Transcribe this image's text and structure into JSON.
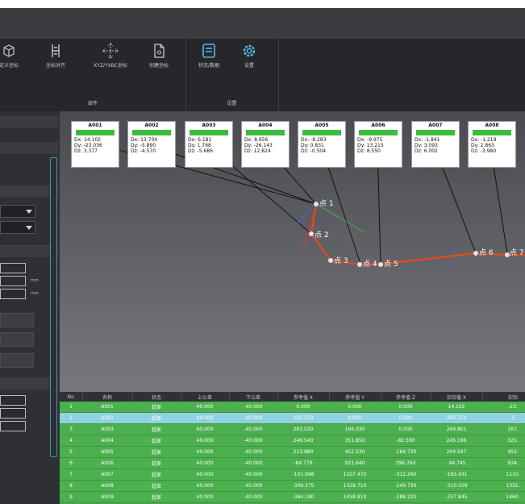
{
  "ribbon": {
    "group1": {
      "title": "部件",
      "buttons": [
        {
          "label": "定义坐标",
          "icon": "cube-axis-icon"
        },
        {
          "label": "坐标对齐",
          "icon": "align-icon"
        },
        {
          "label": "XYZ/YXBC坐标",
          "icon": "move-arrows-icon"
        },
        {
          "label": "创建坐标",
          "icon": "document-icon"
        }
      ]
    },
    "group2": {
      "title": "设置",
      "buttons": [
        {
          "label": "状态/数据",
          "icon": "status-panel-icon"
        },
        {
          "label": "设置",
          "icon": "gear-icon"
        }
      ]
    }
  },
  "leftpanel": {
    "unit_mm_1": "mm",
    "unit_mm_2": "mm"
  },
  "viewport": {
    "point_boxes": [
      {
        "name": "A001",
        "dx": "Dx: 14.102",
        "dy": "Dy: -23.036",
        "dz": "Dz: 3.377"
      },
      {
        "name": "A002",
        "dx": "Dx: 13.704",
        "dy": "Dy: -5.890",
        "dz": "Dz: -4.570"
      },
      {
        "name": "A003",
        "dx": "Dx: 6.181",
        "dy": "Dy: 1.768",
        "dz": "Dz: -5.686"
      },
      {
        "name": "A004",
        "dx": "Dx: 8.656",
        "dy": "Dy: -26.143",
        "dz": "Dz: 12.824"
      },
      {
        "name": "A005",
        "dx": "Dx: -8.283",
        "dy": "Dy: 0.831",
        "dz": "Dz: -0.504"
      },
      {
        "name": "A006",
        "dx": "Dx: -9.975",
        "dy": "Dy: 13.215",
        "dz": "Dz: 8.550"
      },
      {
        "name": "A007",
        "dx": "Dx: -1.841",
        "dy": "Dy: 3.093",
        "dz": "Dz: 6.002"
      },
      {
        "name": "A008",
        "dx": "Dx: -1.219",
        "dy": "Dy: 2.863",
        "dz": "Dz: -3.980"
      }
    ],
    "labels": [
      "点 1",
      "点 2",
      "点 3",
      "点 4",
      "点 5",
      "点 6",
      "点 7"
    ]
  },
  "table": {
    "headers": [
      "No",
      "名称",
      "状态",
      "上公差",
      "下公差",
      "参考值 X",
      "参考值 Y",
      "参考值 Z",
      "实际值 X",
      "实际"
    ],
    "rows": [
      [
        "1",
        "A001",
        "超差",
        "40.000",
        "-40.000",
        "0.000",
        "0.000",
        "0.000",
        "14.102",
        "-23."
      ],
      [
        "2",
        "A002",
        "超差",
        "40.000",
        "-40.000",
        "102.370",
        "0.000",
        "0.000",
        "205.774",
        "-5."
      ],
      [
        "3",
        "A003",
        "超差",
        "40.000",
        "-40.000",
        "263.020",
        "166.030",
        "0.000",
        "269.801",
        "167."
      ],
      [
        "4",
        "A004",
        "超差",
        "40.000",
        "-40.000",
        "246.540",
        "351.850",
        "-82.590",
        "245.196",
        "325."
      ],
      [
        "5",
        "A005",
        "超差",
        "40.000",
        "-40.000",
        "213.880",
        "452.530",
        "-164.730",
        "204.597",
        "453."
      ],
      [
        "6",
        "A006",
        "超差",
        "40.000",
        "-40.000",
        "-84.779",
        "921.640",
        "296.760",
        "-94.745",
        "934."
      ],
      [
        "7",
        "A007",
        "超差",
        "40.000",
        "-40.000",
        "-191.998",
        "1107.470",
        "-312.260",
        "-193.431",
        "1110."
      ],
      [
        "8",
        "A008",
        "超差",
        "40.000",
        "-40.000",
        "-309.375",
        "1328.710",
        "-249.730",
        "-310.509",
        "1331."
      ],
      [
        "9",
        "A009",
        "超差",
        "40.000",
        "-40.000",
        "-364.180",
        "1458.810",
        "-288.220",
        "-357.845",
        "1460."
      ]
    ],
    "selected_row": 2,
    "colors": {
      "row": "#4cb04f",
      "selected": "#8fd3e0",
      "header": "#2f3135"
    }
  }
}
